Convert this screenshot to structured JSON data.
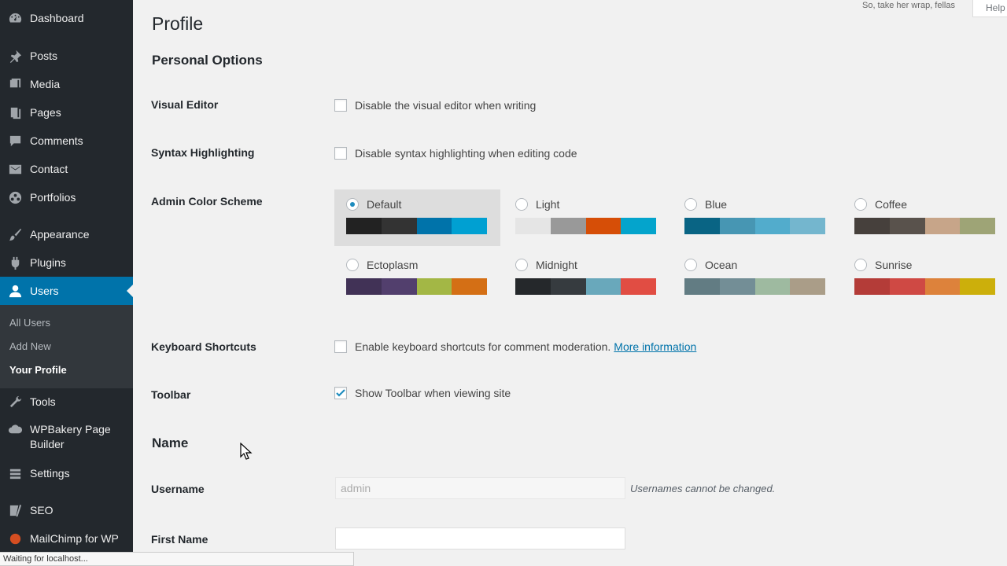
{
  "sidebar": {
    "items": [
      {
        "label": "Dashboard",
        "icon": "dashboard-icon"
      },
      {
        "label": "Posts",
        "icon": "pin-icon"
      },
      {
        "label": "Media",
        "icon": "media-icon"
      },
      {
        "label": "Pages",
        "icon": "pages-icon"
      },
      {
        "label": "Comments",
        "icon": "comments-icon"
      },
      {
        "label": "Contact",
        "icon": "mail-icon"
      },
      {
        "label": "Portfolios",
        "icon": "portfolio-icon"
      },
      {
        "label": "Appearance",
        "icon": "brush-icon"
      },
      {
        "label": "Plugins",
        "icon": "plugin-icon"
      },
      {
        "label": "Users",
        "icon": "user-icon"
      },
      {
        "label": "Tools",
        "icon": "wrench-icon"
      },
      {
        "label": "WPBakery Page Builder",
        "icon": "cloud-icon"
      },
      {
        "label": "Settings",
        "icon": "settings-icon"
      },
      {
        "label": "SEO",
        "icon": "seo-icon"
      },
      {
        "label": "MailChimp for WP",
        "icon": "mailchimp-icon"
      }
    ],
    "submenu": [
      "All Users",
      "Add New",
      "Your Profile"
    ]
  },
  "header": {
    "title": "Profile",
    "note": "So, take her wrap, fellas",
    "help": "Help"
  },
  "personal_options": {
    "title": "Personal Options",
    "visual_editor": {
      "label": "Visual Editor",
      "text": "Disable the visual editor when writing",
      "checked": false
    },
    "syntax": {
      "label": "Syntax Highlighting",
      "text": "Disable syntax highlighting when editing code",
      "checked": false
    },
    "color_scheme": {
      "label": "Admin Color Scheme",
      "selected": "Default",
      "schemes": [
        {
          "name": "Default",
          "colors": [
            "#222222",
            "#333333",
            "#0073aa",
            "#00a0d2"
          ]
        },
        {
          "name": "Light",
          "colors": [
            "#e5e5e5",
            "#999999",
            "#d64e07",
            "#04a4cc"
          ]
        },
        {
          "name": "Blue",
          "colors": [
            "#096484",
            "#4796b3",
            "#52accc",
            "#74b6ce"
          ]
        },
        {
          "name": "Coffee",
          "colors": [
            "#46403c",
            "#59524c",
            "#c7a589",
            "#9ea476"
          ]
        },
        {
          "name": "Ectoplasm",
          "colors": [
            "#413256",
            "#523f6d",
            "#a3b745",
            "#d46f15"
          ]
        },
        {
          "name": "Midnight",
          "colors": [
            "#25282b",
            "#363b3f",
            "#69a8bb",
            "#e14d43"
          ]
        },
        {
          "name": "Ocean",
          "colors": [
            "#627c83",
            "#738e96",
            "#9ebaa0",
            "#aa9d88"
          ]
        },
        {
          "name": "Sunrise",
          "colors": [
            "#b43c38",
            "#cf4944",
            "#dd823b",
            "#ccaf0b"
          ]
        }
      ]
    },
    "keyboard": {
      "label": "Keyboard Shortcuts",
      "text": "Enable keyboard shortcuts for comment moderation.",
      "link": "More information",
      "checked": false
    },
    "toolbar": {
      "label": "Toolbar",
      "text": "Show Toolbar when viewing site",
      "checked": true
    }
  },
  "name_section": {
    "title": "Name",
    "username": {
      "label": "Username",
      "value": "admin",
      "desc": "Usernames cannot be changed."
    },
    "first_name": {
      "label": "First Name",
      "value": ""
    }
  },
  "status": "Waiting for localhost..."
}
